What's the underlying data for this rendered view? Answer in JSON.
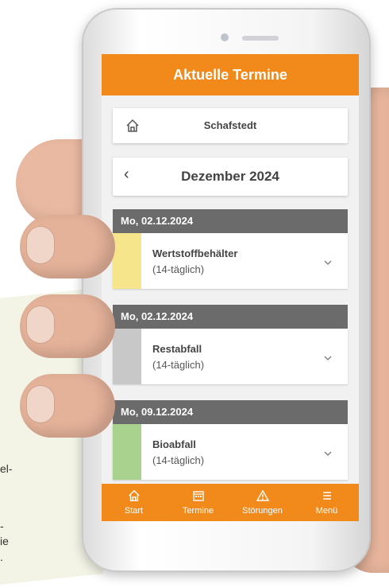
{
  "app": {
    "title": "Aktuelle Termine"
  },
  "location": {
    "name": "Schafstedt",
    "icon": "home-icon"
  },
  "month": {
    "label": "Dezember 2024",
    "prev_icon": "chevron-left-icon"
  },
  "entries": [
    {
      "date": "Mo, 02.12.2024",
      "name": "Wertstoffbehälter",
      "frequency": "(14-täglich)",
      "color": "#f6e58a"
    },
    {
      "date": "Mo, 02.12.2024",
      "name": "Restabfall",
      "frequency": "(14-täglich)",
      "color": "#c8c8c8"
    },
    {
      "date": "Mo, 09.12.2024",
      "name": "Bioabfall",
      "frequency": "(14-täglich)",
      "color": "#a8d28d"
    }
  ],
  "nav": [
    {
      "label": "Start",
      "icon": "home-icon"
    },
    {
      "label": "Termine",
      "icon": "calendar-icon"
    },
    {
      "label": "Störungen",
      "icon": "warning-icon"
    },
    {
      "label": "Menü",
      "icon": "menu-icon"
    }
  ],
  "background_text": [
    "el-",
    "-",
    "ie",
    "."
  ],
  "colors": {
    "accent": "#f18a1a",
    "date_header": "#6b6b6b"
  }
}
